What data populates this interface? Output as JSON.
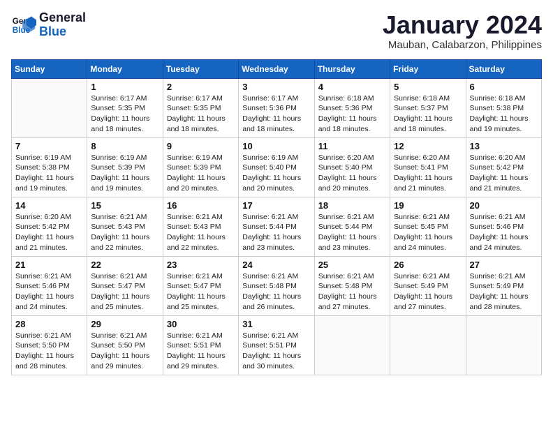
{
  "logo": {
    "line1": "General",
    "line2": "Blue"
  },
  "title": "January 2024",
  "subtitle": "Mauban, Calabarzon, Philippines",
  "days_of_week": [
    "Sunday",
    "Monday",
    "Tuesday",
    "Wednesday",
    "Thursday",
    "Friday",
    "Saturday"
  ],
  "weeks": [
    [
      {
        "day": "",
        "info": ""
      },
      {
        "day": "1",
        "info": "Sunrise: 6:17 AM\nSunset: 5:35 PM\nDaylight: 11 hours and 18 minutes."
      },
      {
        "day": "2",
        "info": "Sunrise: 6:17 AM\nSunset: 5:35 PM\nDaylight: 11 hours and 18 minutes."
      },
      {
        "day": "3",
        "info": "Sunrise: 6:17 AM\nSunset: 5:36 PM\nDaylight: 11 hours and 18 minutes."
      },
      {
        "day": "4",
        "info": "Sunrise: 6:18 AM\nSunset: 5:36 PM\nDaylight: 11 hours and 18 minutes."
      },
      {
        "day": "5",
        "info": "Sunrise: 6:18 AM\nSunset: 5:37 PM\nDaylight: 11 hours and 18 minutes."
      },
      {
        "day": "6",
        "info": "Sunrise: 6:18 AM\nSunset: 5:38 PM\nDaylight: 11 hours and 19 minutes."
      }
    ],
    [
      {
        "day": "7",
        "info": "Sunrise: 6:19 AM\nSunset: 5:38 PM\nDaylight: 11 hours and 19 minutes."
      },
      {
        "day": "8",
        "info": "Sunrise: 6:19 AM\nSunset: 5:39 PM\nDaylight: 11 hours and 19 minutes."
      },
      {
        "day": "9",
        "info": "Sunrise: 6:19 AM\nSunset: 5:39 PM\nDaylight: 11 hours and 20 minutes."
      },
      {
        "day": "10",
        "info": "Sunrise: 6:19 AM\nSunset: 5:40 PM\nDaylight: 11 hours and 20 minutes."
      },
      {
        "day": "11",
        "info": "Sunrise: 6:20 AM\nSunset: 5:40 PM\nDaylight: 11 hours and 20 minutes."
      },
      {
        "day": "12",
        "info": "Sunrise: 6:20 AM\nSunset: 5:41 PM\nDaylight: 11 hours and 21 minutes."
      },
      {
        "day": "13",
        "info": "Sunrise: 6:20 AM\nSunset: 5:42 PM\nDaylight: 11 hours and 21 minutes."
      }
    ],
    [
      {
        "day": "14",
        "info": "Sunrise: 6:20 AM\nSunset: 5:42 PM\nDaylight: 11 hours and 21 minutes."
      },
      {
        "day": "15",
        "info": "Sunrise: 6:21 AM\nSunset: 5:43 PM\nDaylight: 11 hours and 22 minutes."
      },
      {
        "day": "16",
        "info": "Sunrise: 6:21 AM\nSunset: 5:43 PM\nDaylight: 11 hours and 22 minutes."
      },
      {
        "day": "17",
        "info": "Sunrise: 6:21 AM\nSunset: 5:44 PM\nDaylight: 11 hours and 23 minutes."
      },
      {
        "day": "18",
        "info": "Sunrise: 6:21 AM\nSunset: 5:44 PM\nDaylight: 11 hours and 23 minutes."
      },
      {
        "day": "19",
        "info": "Sunrise: 6:21 AM\nSunset: 5:45 PM\nDaylight: 11 hours and 24 minutes."
      },
      {
        "day": "20",
        "info": "Sunrise: 6:21 AM\nSunset: 5:46 PM\nDaylight: 11 hours and 24 minutes."
      }
    ],
    [
      {
        "day": "21",
        "info": "Sunrise: 6:21 AM\nSunset: 5:46 PM\nDaylight: 11 hours and 24 minutes."
      },
      {
        "day": "22",
        "info": "Sunrise: 6:21 AM\nSunset: 5:47 PM\nDaylight: 11 hours and 25 minutes."
      },
      {
        "day": "23",
        "info": "Sunrise: 6:21 AM\nSunset: 5:47 PM\nDaylight: 11 hours and 25 minutes."
      },
      {
        "day": "24",
        "info": "Sunrise: 6:21 AM\nSunset: 5:48 PM\nDaylight: 11 hours and 26 minutes."
      },
      {
        "day": "25",
        "info": "Sunrise: 6:21 AM\nSunset: 5:48 PM\nDaylight: 11 hours and 27 minutes."
      },
      {
        "day": "26",
        "info": "Sunrise: 6:21 AM\nSunset: 5:49 PM\nDaylight: 11 hours and 27 minutes."
      },
      {
        "day": "27",
        "info": "Sunrise: 6:21 AM\nSunset: 5:49 PM\nDaylight: 11 hours and 28 minutes."
      }
    ],
    [
      {
        "day": "28",
        "info": "Sunrise: 6:21 AM\nSunset: 5:50 PM\nDaylight: 11 hours and 28 minutes."
      },
      {
        "day": "29",
        "info": "Sunrise: 6:21 AM\nSunset: 5:50 PM\nDaylight: 11 hours and 29 minutes."
      },
      {
        "day": "30",
        "info": "Sunrise: 6:21 AM\nSunset: 5:51 PM\nDaylight: 11 hours and 29 minutes."
      },
      {
        "day": "31",
        "info": "Sunrise: 6:21 AM\nSunset: 5:51 PM\nDaylight: 11 hours and 30 minutes."
      },
      {
        "day": "",
        "info": ""
      },
      {
        "day": "",
        "info": ""
      },
      {
        "day": "",
        "info": ""
      }
    ]
  ],
  "colors": {
    "header_bg": "#1565C0",
    "accent": "#1a1a2e"
  }
}
